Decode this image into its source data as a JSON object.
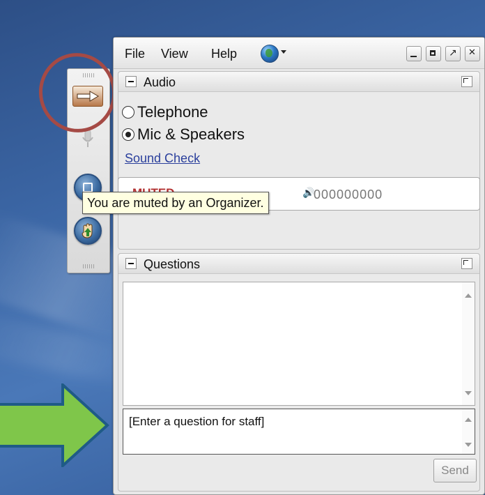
{
  "menu": {
    "file": "File",
    "view": "View",
    "help": "Help"
  },
  "audio": {
    "title": "Audio",
    "options": [
      {
        "label": "Telephone",
        "selected": false
      },
      {
        "label": "Mic & Speakers",
        "selected": true
      }
    ],
    "sound_check": "Sound Check",
    "muted_label": "MUTED",
    "access_code": "000000000"
  },
  "tooltip": "You are muted by an Organizer.",
  "questions": {
    "title": "Questions",
    "input_text": "[Enter a question for staff]",
    "send_label": "Send"
  },
  "colors": {
    "highlight_ring": "#a54a45",
    "callout_arrow": "#7fc64a",
    "callout_arrow_border": "#1f5b86",
    "muted": "#b23030"
  }
}
